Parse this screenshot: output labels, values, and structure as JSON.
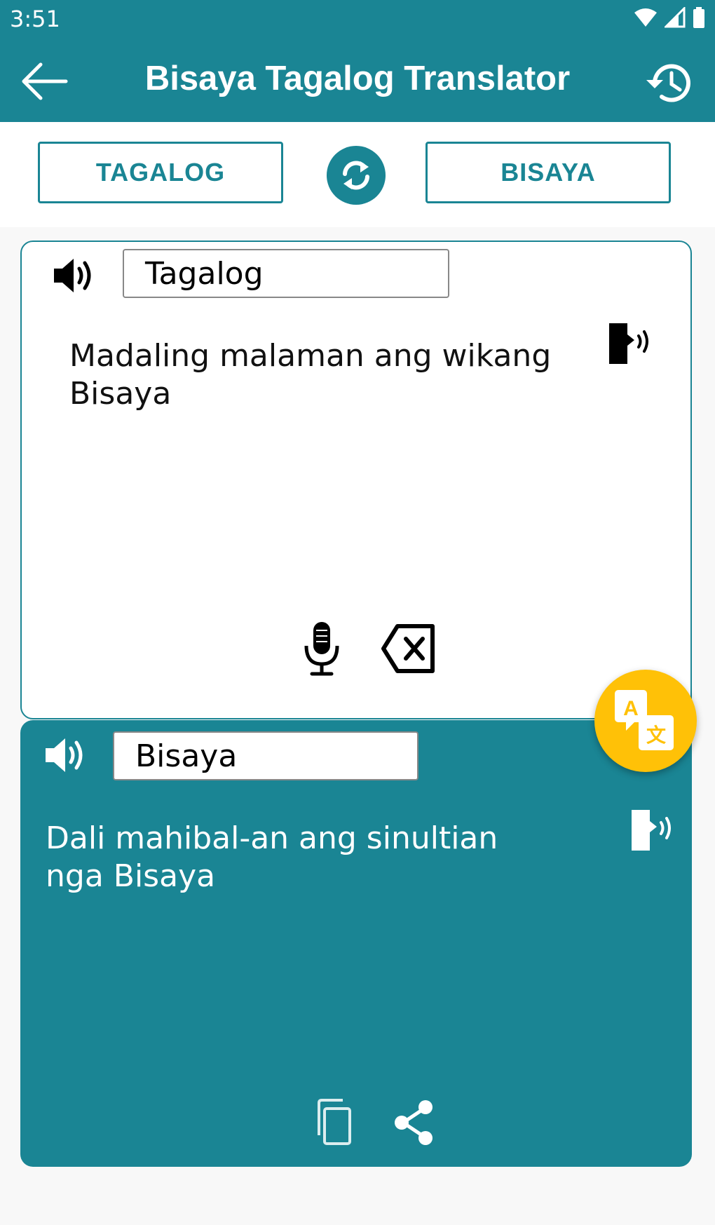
{
  "status_bar": {
    "time": "3:51"
  },
  "app_bar": {
    "title": "Bisaya Tagalog Translator"
  },
  "languages": {
    "source_button": "TAGALOG",
    "target_button": "BISAYA"
  },
  "input_card": {
    "language_label": "Tagalog",
    "text": "Madaling malaman ang wikang Bisaya"
  },
  "output_card": {
    "language_label": "Bisaya",
    "text": "Dali mahibal-an ang sinultian nga Bisaya"
  },
  "colors": {
    "primary": "#1a8594",
    "accent": "#ffc107",
    "background": "#f8f8f8"
  }
}
